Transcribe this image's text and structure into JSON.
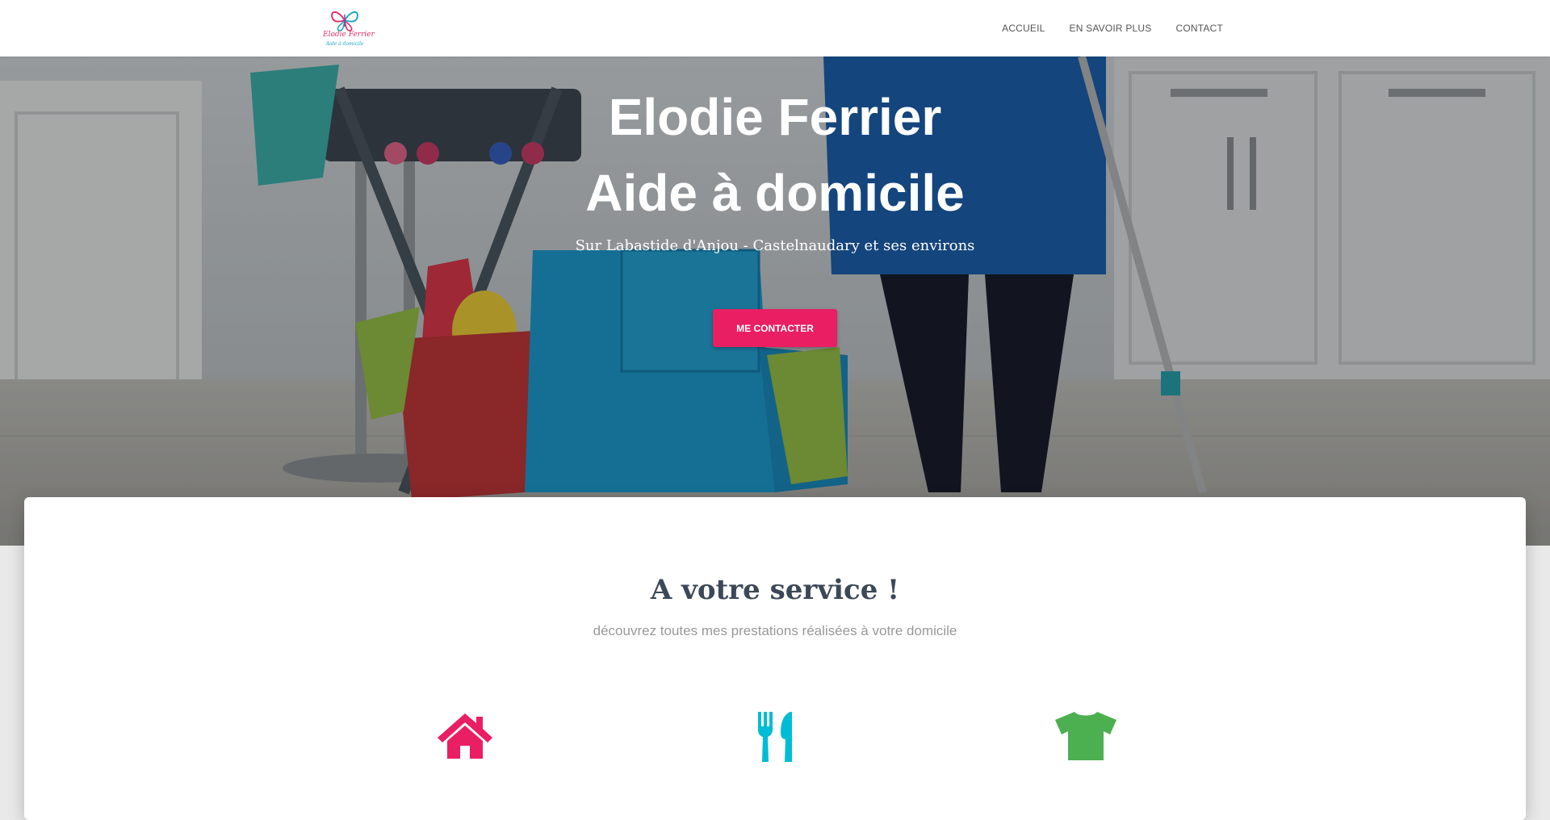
{
  "logo": {
    "name": "Elodie Ferrier",
    "tagline": "Aide à domicile",
    "icon": "butterfly-logo-icon"
  },
  "nav": {
    "items": [
      {
        "label": "ACCUEIL"
      },
      {
        "label": "EN SAVOIR PLUS"
      },
      {
        "label": "CONTACT"
      }
    ]
  },
  "hero": {
    "title_line1": "Elodie Ferrier",
    "title_line2": "Aide à domicile",
    "subtitle": "Sur Labastide d'Anjou - Castelnaudary et ses environs",
    "button_label": "ME CONTACTER"
  },
  "services": {
    "title": "A votre service !",
    "subtitle": "découvrez toutes mes prestations réalisées à votre domicile",
    "items": [
      {
        "icon": "home-icon",
        "color": "#e91e63"
      },
      {
        "icon": "cutlery-icon",
        "color": "#00bcd4"
      },
      {
        "icon": "tshirt-icon",
        "color": "#4caf50"
      }
    ]
  },
  "colors": {
    "accent": "#e91e63",
    "heading": "#3c4858",
    "muted": "#999999"
  }
}
